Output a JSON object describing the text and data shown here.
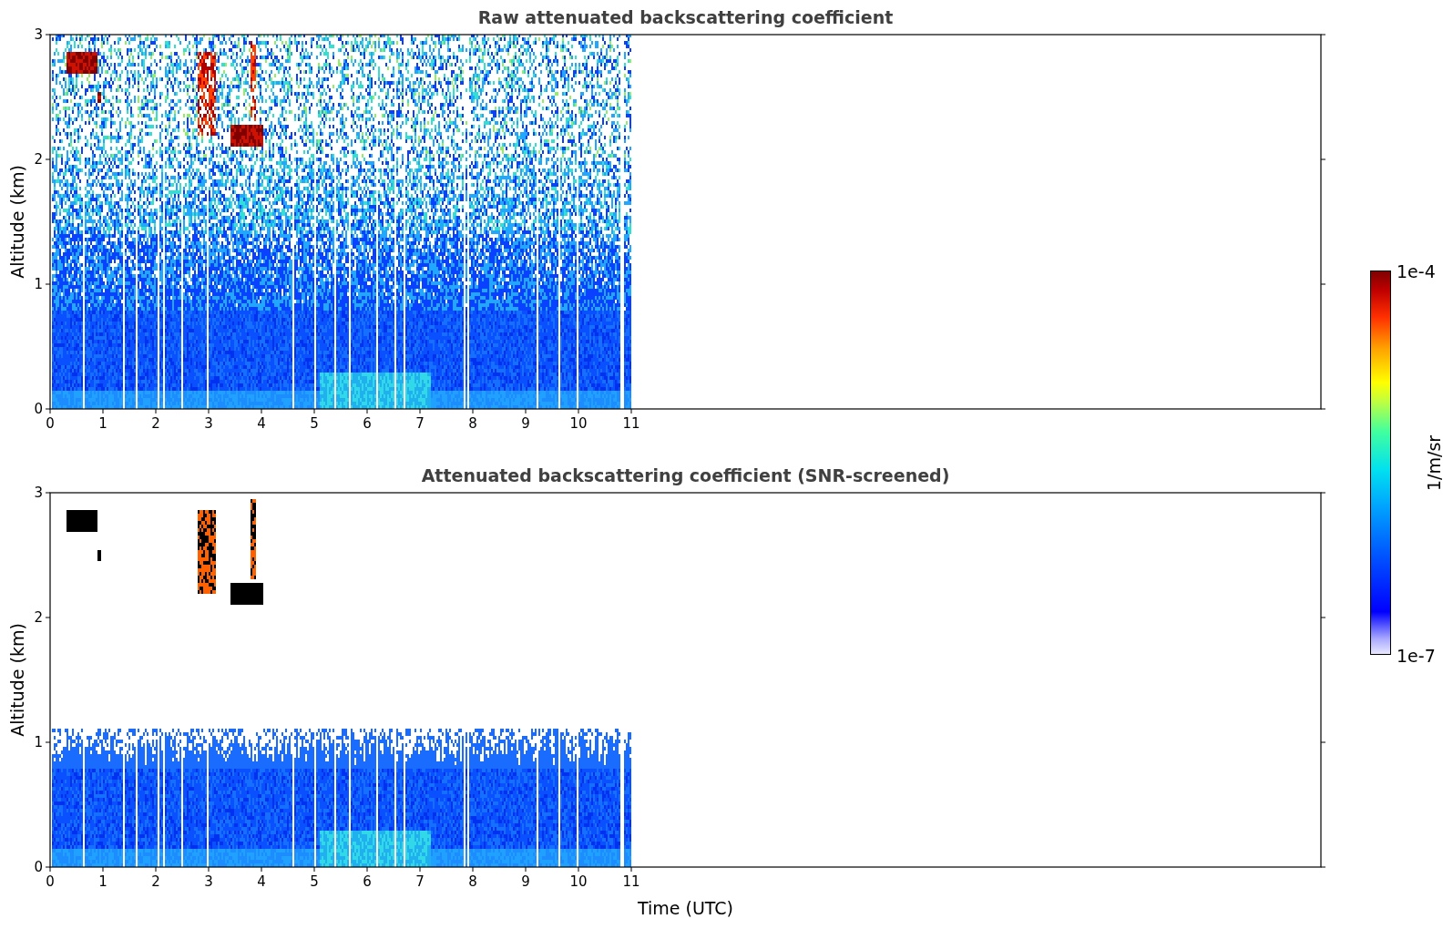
{
  "panels": [
    {
      "kind": "raw",
      "title": "Raw attenuated backscattering coefficient",
      "ylabel": "Altitude (km)",
      "yticks": [
        "3",
        "2",
        "1",
        "0"
      ],
      "xticks": [
        "0",
        "1",
        "2",
        "3",
        "4",
        "5",
        "6",
        "7",
        "8",
        "9",
        "10",
        "11"
      ]
    },
    {
      "kind": "screened",
      "title": "Attenuated backscattering coefficient (SNR-screened)",
      "ylabel": "Altitude (km)",
      "yticks": [
        "3",
        "2",
        "1",
        "0"
      ],
      "xticks": [
        "0",
        "1",
        "2",
        "3",
        "4",
        "5",
        "6",
        "7",
        "8",
        "9",
        "10",
        "11"
      ],
      "xlabel": "Time (UTC)"
    }
  ],
  "colorbar": {
    "max_label": "1e-4",
    "min_label": "1e-7",
    "label": "1/m/sr"
  }
}
